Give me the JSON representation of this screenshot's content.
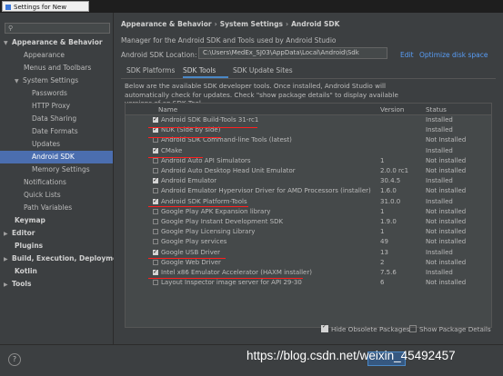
{
  "window": {
    "title": "Settings for New Projects"
  },
  "search": {
    "placeholder": ""
  },
  "sidebar": {
    "items": [
      {
        "label": "Appearance & Behavior"
      },
      {
        "label": "Appearance"
      },
      {
        "label": "Menus and Toolbars"
      },
      {
        "label": "System Settings"
      },
      {
        "label": "Passwords"
      },
      {
        "label": "HTTP Proxy"
      },
      {
        "label": "Data Sharing"
      },
      {
        "label": "Date Formats"
      },
      {
        "label": "Updates"
      },
      {
        "label": "Android SDK"
      },
      {
        "label": "Memory Settings"
      },
      {
        "label": "Notifications"
      },
      {
        "label": "Quick Lists"
      },
      {
        "label": "Path Variables"
      },
      {
        "label": "Keymap"
      },
      {
        "label": "Editor"
      },
      {
        "label": "Plugins"
      },
      {
        "label": "Build, Execution, Deployment"
      },
      {
        "label": "Kotlin"
      },
      {
        "label": "Tools"
      }
    ]
  },
  "breadcrumb": [
    "Appearance & Behavior",
    "System Settings",
    "Android SDK"
  ],
  "breadcrumb_sep": "›",
  "description": "Manager for the Android SDK and Tools used by Android Studio",
  "sdk_location": {
    "label": "Android SDK Location:",
    "value": "C:\\Users\\MedEx_SJ03\\AppData\\Local\\Android\\Sdk",
    "edit": "Edit",
    "optimize": "Optimize disk space"
  },
  "tabs": [
    "SDK Platforms",
    "SDK Tools",
    "SDK Update Sites"
  ],
  "info": "Below are the available SDK developer tools. Once installed, Android Studio will automatically check for updates. Check \"show package details\" to display available versions of an SDK Tool.",
  "table": {
    "headers": {
      "name": "Name",
      "version": "Version",
      "status": "Status"
    },
    "rows": [
      {
        "name": "Android SDK Build-Tools 31-rc1",
        "version": "",
        "status": "Installed",
        "checked": true
      },
      {
        "name": "NDK (Side by side)",
        "version": "",
        "status": "Installed",
        "checked": true
      },
      {
        "name": "Android SDK Command-line Tools (latest)",
        "version": "",
        "status": "Not Installed",
        "checked": false
      },
      {
        "name": "CMake",
        "version": "",
        "status": "Installed",
        "checked": true
      },
      {
        "name": "Android Auto API Simulators",
        "version": "1",
        "status": "Not installed",
        "checked": false
      },
      {
        "name": "Android Auto Desktop Head Unit Emulator",
        "version": "2.0.0 rc1",
        "status": "Not installed",
        "checked": false
      },
      {
        "name": "Android Emulator",
        "version": "30.4.5",
        "status": "Installed",
        "checked": true
      },
      {
        "name": "Android Emulator Hypervisor Driver for AMD Processors (installer)",
        "version": "1.6.0",
        "status": "Not installed",
        "checked": false
      },
      {
        "name": "Android SDK Platform-Tools",
        "version": "31.0.0",
        "status": "Installed",
        "checked": true
      },
      {
        "name": "Google Play APK Expansion library",
        "version": "1",
        "status": "Not installed",
        "checked": false
      },
      {
        "name": "Google Play Instant Development SDK",
        "version": "1.9.0",
        "status": "Not installed",
        "checked": false
      },
      {
        "name": "Google Play Licensing Library",
        "version": "1",
        "status": "Not installed",
        "checked": false
      },
      {
        "name": "Google Play services",
        "version": "49",
        "status": "Not installed",
        "checked": false
      },
      {
        "name": "Google USB Driver",
        "version": "13",
        "status": "Installed",
        "checked": true
      },
      {
        "name": "Google Web Driver",
        "version": "2",
        "status": "Not installed",
        "checked": false
      },
      {
        "name": "Intel x86 Emulator Accelerator (HAXM installer)",
        "version": "7.5.6",
        "status": "Installed",
        "checked": true
      },
      {
        "name": "Layout Inspector image server for API 29-30",
        "version": "6",
        "status": "Not installed",
        "checked": false
      }
    ]
  },
  "options": {
    "hide_obsolete": {
      "label": "Hide Obsolete Packages",
      "checked": true
    },
    "show_details": {
      "label": "Show Package Details",
      "checked": false
    }
  },
  "help": "?",
  "watermark": "https://blog.csdn.net/weixin_45492457",
  "colors": {
    "accent": "#4a88c7",
    "selection": "#4b6eaf",
    "link": "#589df6",
    "annotation": "#ff1f1f"
  }
}
